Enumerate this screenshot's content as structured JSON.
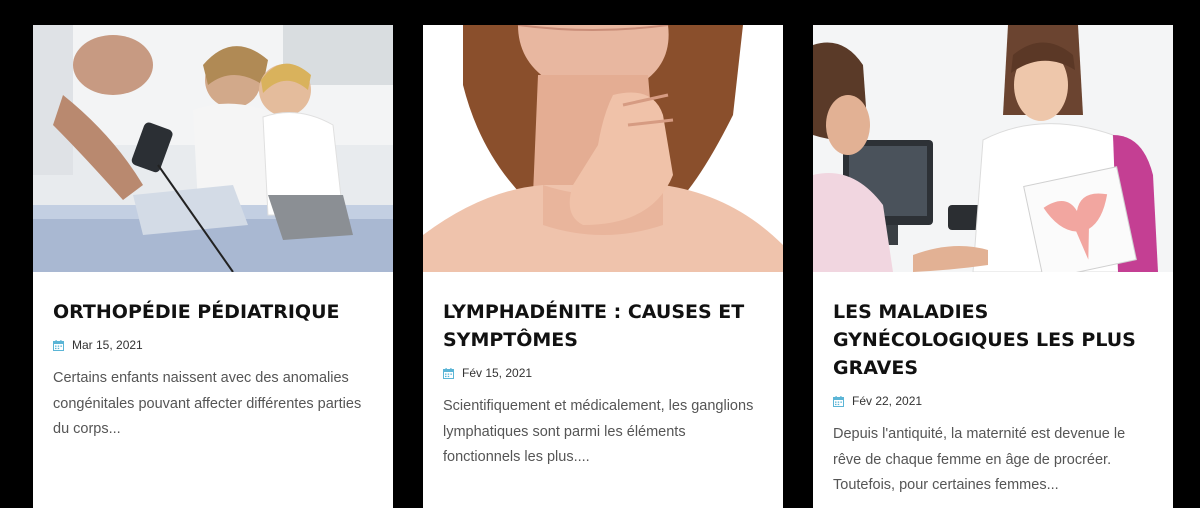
{
  "posts": [
    {
      "title": "ORTHOPÉDIE PÉDIATRIQUE",
      "date": "Mar 15, 2021",
      "excerpt": "Certains enfants naissent avec des anomalies congénitales pouvant affecter différentes parties du corps...",
      "image": "doctor-treating-child-leg-cast"
    },
    {
      "title": "LYMPHADÉNITE : CAUSES ET SYMPTÔMES",
      "date": "Fév 15, 2021",
      "excerpt": "Scientifiquement et médicalement, les ganglions lymphatiques sont parmi les éléments fonctionnels les plus....",
      "image": "woman-touching-neck"
    },
    {
      "title": "LES MALADIES GYNÉCOLOGIQUES LES PLUS GRAVES",
      "date": "Fév 22, 2021",
      "excerpt": "Depuis l'antiquité, la maternité est devenue le rêve de chaque femme en âge de procréer. Toutefois, pour certaines femmes...",
      "image": "gynecologist-with-uterus-diagram"
    }
  ],
  "colors": {
    "background": "#000000",
    "card": "#ffffff",
    "title": "#111111",
    "text": "#555555",
    "calendar_icon": "#5bb5d6"
  }
}
